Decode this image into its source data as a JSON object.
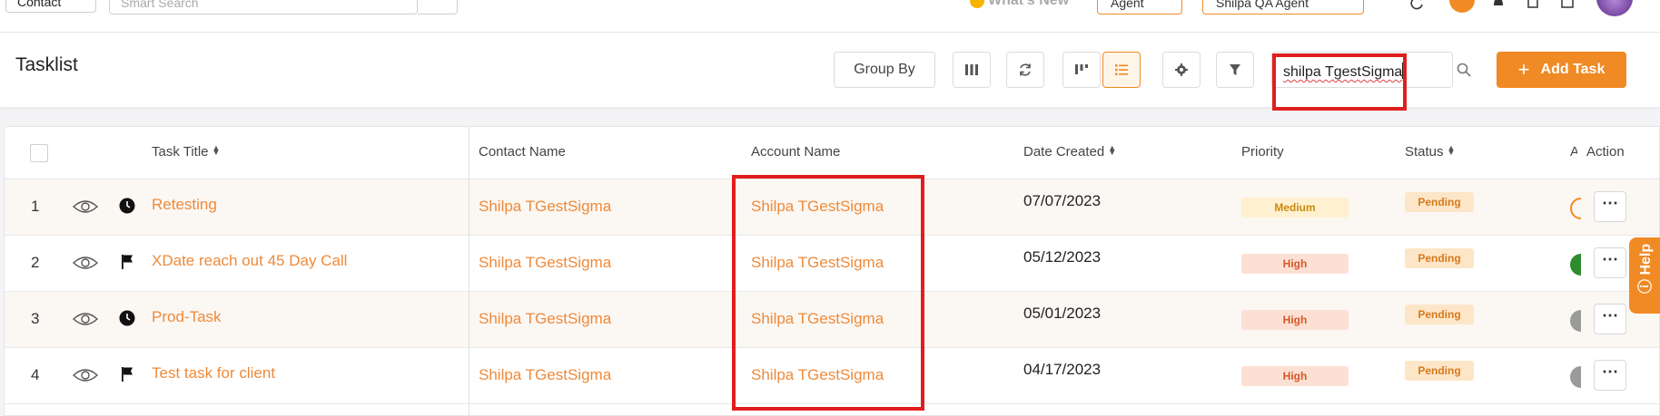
{
  "topbar": {
    "module_select": "Contact",
    "smart_search_placeholder": "Smart Search",
    "whats_new": "What's New",
    "role_select": "Agent",
    "user_select": "Shilpa QA Agent"
  },
  "header": {
    "title": "Tasklist",
    "group_by_label": "Group By",
    "search_value": "shilpa TgestSigma",
    "add_task_label": "Add Task"
  },
  "table": {
    "columns": {
      "task_title": "Task Title",
      "contact_name": "Contact Name",
      "account_name": "Account Name",
      "date_created": "Date Created",
      "priority": "Priority",
      "status": "Status",
      "assigned": "A",
      "action": "Action"
    },
    "rows": [
      {
        "num": "1",
        "type_icon": "clock-icon",
        "title": "Retesting",
        "contact": "Shilpa TGestSigma",
        "account": "Shilpa TGestSigma",
        "date": "07/07/2023",
        "priority": "Medium",
        "status": "Pending"
      },
      {
        "num": "2",
        "type_icon": "flag-icon",
        "title": "XDate reach out 45 Day Call",
        "contact": "Shilpa TGestSigma",
        "account": "Shilpa TGestSigma",
        "date": "05/12/2023",
        "priority": "High",
        "status": "Pending"
      },
      {
        "num": "3",
        "type_icon": "clock-icon",
        "title": "Prod-Task",
        "contact": "Shilpa TGestSigma",
        "account": "Shilpa TGestSigma",
        "date": "05/01/2023",
        "priority": "High",
        "status": "Pending"
      },
      {
        "num": "4",
        "type_icon": "flag-icon",
        "title": "Test task for client",
        "contact": "Shilpa TGestSigma",
        "account": "Shilpa TGestSigma",
        "date": "04/17/2023",
        "priority": "High",
        "status": "Pending"
      }
    ],
    "action_glyph": "⋯"
  },
  "help_tab": {
    "label": "Help"
  },
  "colors": {
    "accent": "#f08a24",
    "link": "#ee8a3a",
    "highlight": "#e01e1e"
  }
}
